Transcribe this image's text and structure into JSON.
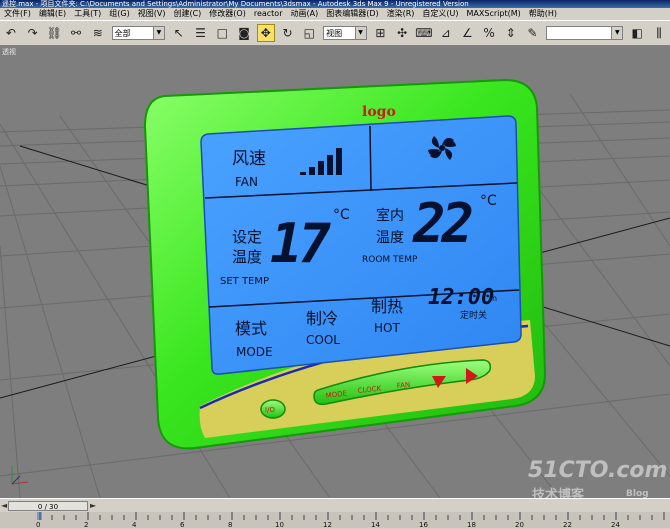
{
  "title": "遥控.max - 项目文件夹: C:\\Documents and Settings\\Administrator\\My Documents\\3dsmax - Autodesk 3ds Max 9 - Unregistered Version",
  "menu": [
    "文件(F)",
    "编辑(E)",
    "工具(T)",
    "组(G)",
    "视图(V)",
    "创建(C)",
    "修改器(O)",
    "reactor",
    "动画(A)",
    "图表编辑器(D)",
    "渲染(R)",
    "自定义(U)",
    "MAXScript(M)",
    "帮助(H)"
  ],
  "toolbar": {
    "selection_filter": "全部",
    "reference_coord": "视图",
    "named_set": ""
  },
  "viewport": {
    "label": "透视"
  },
  "thermostat": {
    "logo": "logo",
    "fan_cn": "风速",
    "fan_en": "FAN",
    "set_cn1": "设定",
    "set_cn2": "温度",
    "set_temp": "17",
    "set_unit": "°C",
    "set_en": "SET TEMP",
    "room_cn1": "室内",
    "room_cn2": "温度",
    "room_temp": "22",
    "room_unit": "°C",
    "room_en": "ROOM TEMP",
    "clock": "12:00",
    "clock_h": "h",
    "timer_cn": "定时关",
    "mode_cn": "模式",
    "mode_en": "MODE",
    "cool_cn": "制冷",
    "cool_en": "COOL",
    "hot_cn": "制热",
    "hot_en": "HOT",
    "btn_mode": "MODE",
    "btn_clock": "CLOCK",
    "btn_fan": "FAN",
    "btn_power": "I/O"
  },
  "timeline": {
    "frame": "0 / 30"
  },
  "ruler_ticks": [
    "0",
    "2",
    "4",
    "6",
    "8",
    "10",
    "12",
    "14",
    "16",
    "18",
    "20",
    "22",
    "24"
  ],
  "watermark": {
    "site": "51CTO.com",
    "sub": "技术博客",
    "blog": "Blog"
  },
  "colors": {
    "body": "#39e61e",
    "lcd": "#3f95ff",
    "lcd_ink": "#05112e",
    "bottom": "#d8cf5a",
    "buttons": "#d01818"
  }
}
